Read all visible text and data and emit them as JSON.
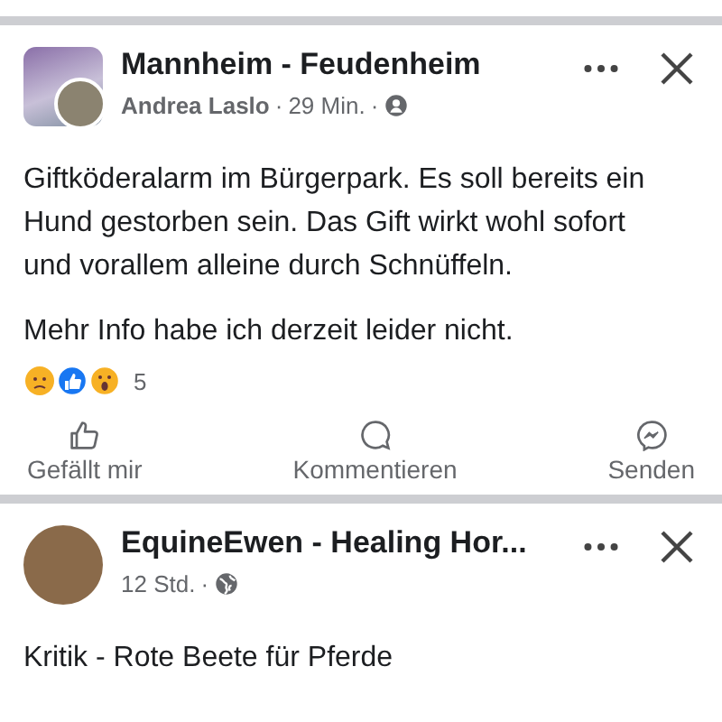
{
  "posts": [
    {
      "avatar": {
        "kind": "group"
      },
      "title": "Mannheim - Feudenheim",
      "meta": [
        {
          "kind": "author",
          "text": "Andrea Laslo"
        },
        {
          "kind": "separator",
          "text": "·"
        },
        {
          "kind": "time",
          "text": "29 Min."
        },
        {
          "kind": "separator",
          "text": "·"
        },
        {
          "kind": "group_icon"
        }
      ],
      "body": [
        "Giftköderalarm im Bürgerpark. Es soll bereits ein Hund gestorben sein. Das Gift wirkt wohl sofort und vorallem alleine durch Schnüffeln.",
        "Mehr Info habe ich derzeit leider nicht."
      ],
      "reaction_count": "5",
      "actions": [
        {
          "kind": "like",
          "label": "Gefällt mir"
        },
        {
          "kind": "comment",
          "label": "Kommentieren"
        },
        {
          "kind": "send",
          "label": "Senden"
        }
      ]
    },
    {
      "avatar": {
        "kind": "person"
      },
      "title": "EquineEwen - Healing Hor...",
      "meta": [
        {
          "kind": "time",
          "text": "12 Std."
        },
        {
          "kind": "separator",
          "text": "·"
        },
        {
          "kind": "globe_icon"
        }
      ],
      "body": [
        "Kritik - Rote Beete für Pferde"
      ]
    }
  ]
}
